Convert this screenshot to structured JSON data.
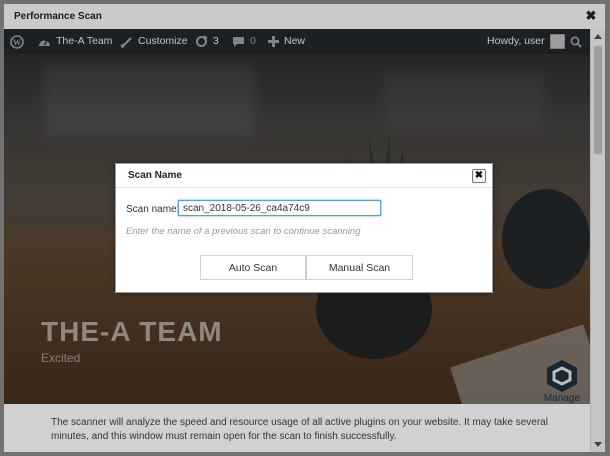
{
  "window": {
    "title": "Performance Scan",
    "close_glyph": "✖"
  },
  "adminbar": {
    "site_name": "The-A Team",
    "customize": "Customize",
    "updates_count": "3",
    "comments_count": "0",
    "new_label": "New",
    "greeting": "Howdy, user"
  },
  "hero": {
    "title": "THE-A TEAM",
    "subtitle": "Excited",
    "manage_label": "Manage"
  },
  "footer_note": "The scanner will analyze the speed and resource usage of all active plugins on your website. It may take several minutes, and this window must remain open for the scan to finish successfully.",
  "modal": {
    "title": "Scan Name",
    "close_glyph": "✖",
    "field_label": "Scan name:",
    "field_value": "scan_2018-05-26_ca4a74c9",
    "hint": "Enter the name of a previous scan to continue scanning",
    "auto_button": "Auto Scan",
    "manual_button": "Manual Scan"
  },
  "colors": {
    "adminbar_bg": "#23282d",
    "input_focus": "#5b9dd9",
    "manage_icon": "#1d2f3e"
  }
}
